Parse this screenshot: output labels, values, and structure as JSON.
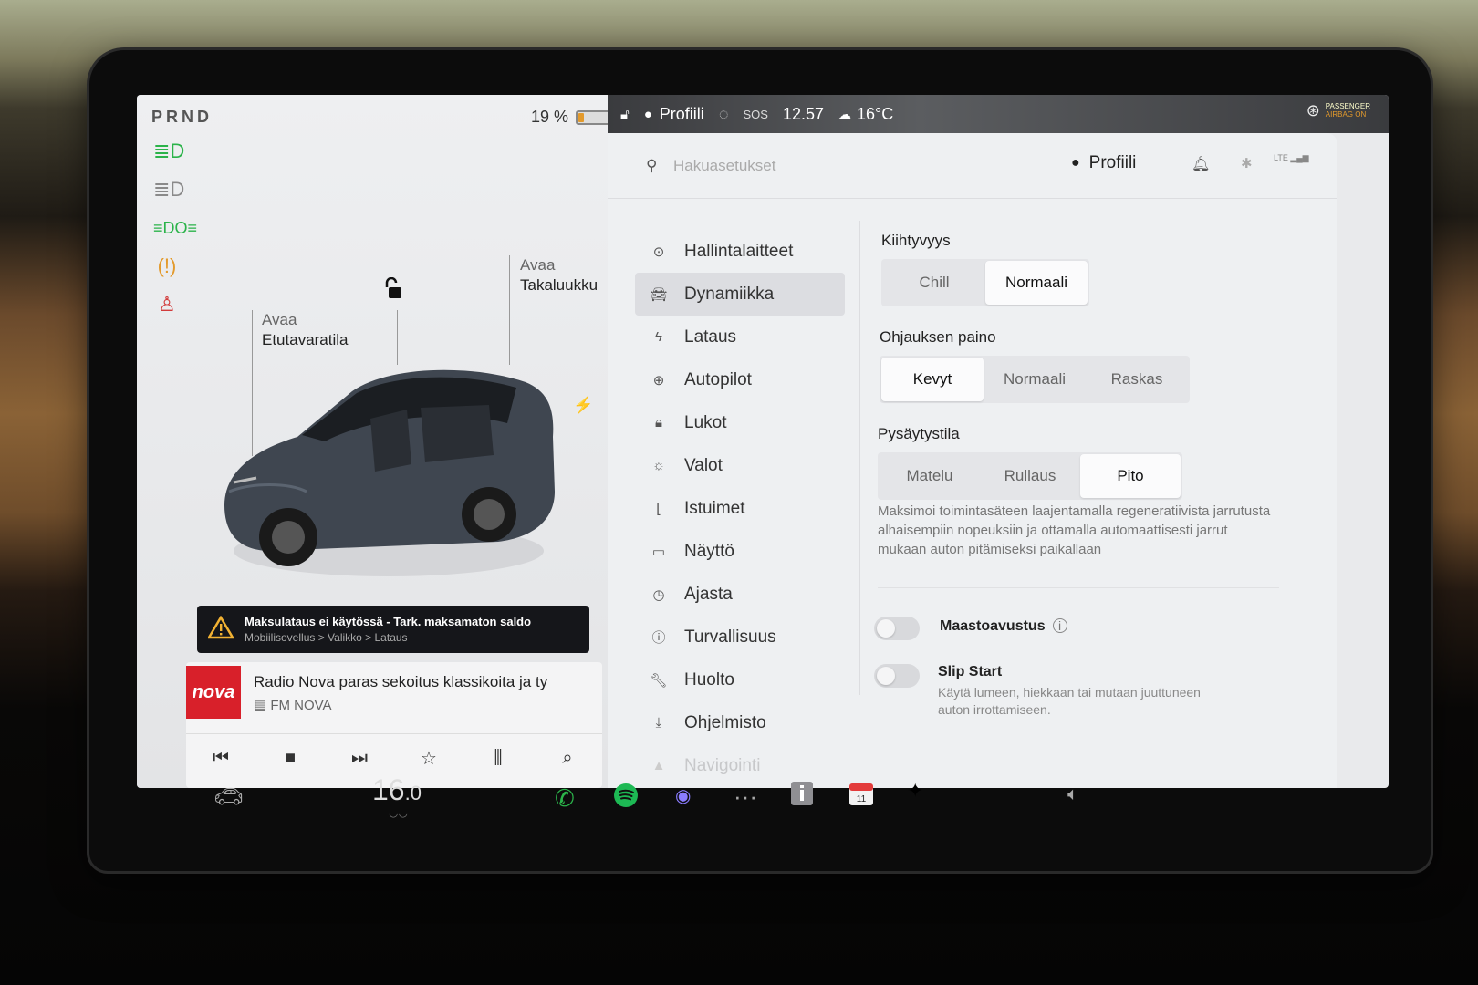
{
  "status": {
    "prnd": "PRND",
    "battery_percent_label": "19 %",
    "battery_level": 0.19,
    "topbar_profile": "Profiili",
    "sos": "SOS",
    "time": "12.57",
    "weather_temp": "16°C",
    "airbag_line1": "PASSENGER",
    "airbag_line2": "AIRBAG ON"
  },
  "car": {
    "front_trunk_action": "Avaa",
    "front_trunk_name": "Etutavaratila",
    "rear_trunk_action": "Avaa",
    "rear_trunk_name": "Takaluukku"
  },
  "alert": {
    "title": "Maksulataus ei käytössä - Tark. maksamaton saldo",
    "subtitle": "Mobiilisovellus > Valikko > Lataus"
  },
  "media": {
    "logo_text": "nova",
    "title": "Radio Nova paras sekoitus klassikoita ja ty",
    "station": "FM NOVA"
  },
  "settings": {
    "search_placeholder": "Hakuasetukset",
    "profile_label": "Profiili",
    "menu": [
      {
        "label": "Hallintalaitteet",
        "icon": "toggle-icon"
      },
      {
        "label": "Dynamiikka",
        "icon": "car-icon"
      },
      {
        "label": "Lataus",
        "icon": "bolt-icon"
      },
      {
        "label": "Autopilot",
        "icon": "steering-wheel-icon"
      },
      {
        "label": "Lukot",
        "icon": "lock-icon"
      },
      {
        "label": "Valot",
        "icon": "sun-icon"
      },
      {
        "label": "Istuimet",
        "icon": "seat-icon"
      },
      {
        "label": "Näyttö",
        "icon": "display-icon"
      },
      {
        "label": "Ajasta",
        "icon": "clock-icon"
      },
      {
        "label": "Turvallisuus",
        "icon": "safety-icon"
      },
      {
        "label": "Huolto",
        "icon": "wrench-icon"
      },
      {
        "label": "Ohjelmisto",
        "icon": "download-icon"
      },
      {
        "label": "Navigointi",
        "icon": "navigation-icon"
      }
    ],
    "active_menu": "Dynamiikka",
    "acceleration": {
      "title": "Kiihtyvyys",
      "options": [
        "Chill",
        "Normaali"
      ],
      "selected": "Normaali"
    },
    "steering": {
      "title": "Ohjauksen paino",
      "options": [
        "Kevyt",
        "Normaali",
        "Raskas"
      ],
      "selected": "Kevyt"
    },
    "stopping": {
      "title": "Pysäytystila",
      "options": [
        "Matelu",
        "Rullaus",
        "Pito"
      ],
      "selected": "Pito"
    },
    "stopping_description": "Maksimoi toimintasäteen laajentamalla regeneratiivista jarrutusta alhaisempiin nopeuksiin ja ottamalla automaattisesti jarrut mukaan auton pitämiseksi paikallaan",
    "offroad": {
      "label": "Maastoavustus",
      "enabled": false
    },
    "slipstart": {
      "label": "Slip Start",
      "description": "Käytä lumeen, hiekkaan tai mutaan juuttuneen auton irrottamiseen.",
      "enabled": false
    }
  },
  "dock": {
    "cabin_temp_main": "16",
    "cabin_temp_decimal": ".0",
    "calendar_day": "11"
  },
  "colors": {
    "accent_green": "#1db954",
    "alert_bg": "#15161a",
    "nova_red": "#d8202a",
    "battery_orange": "#e39a2c"
  }
}
